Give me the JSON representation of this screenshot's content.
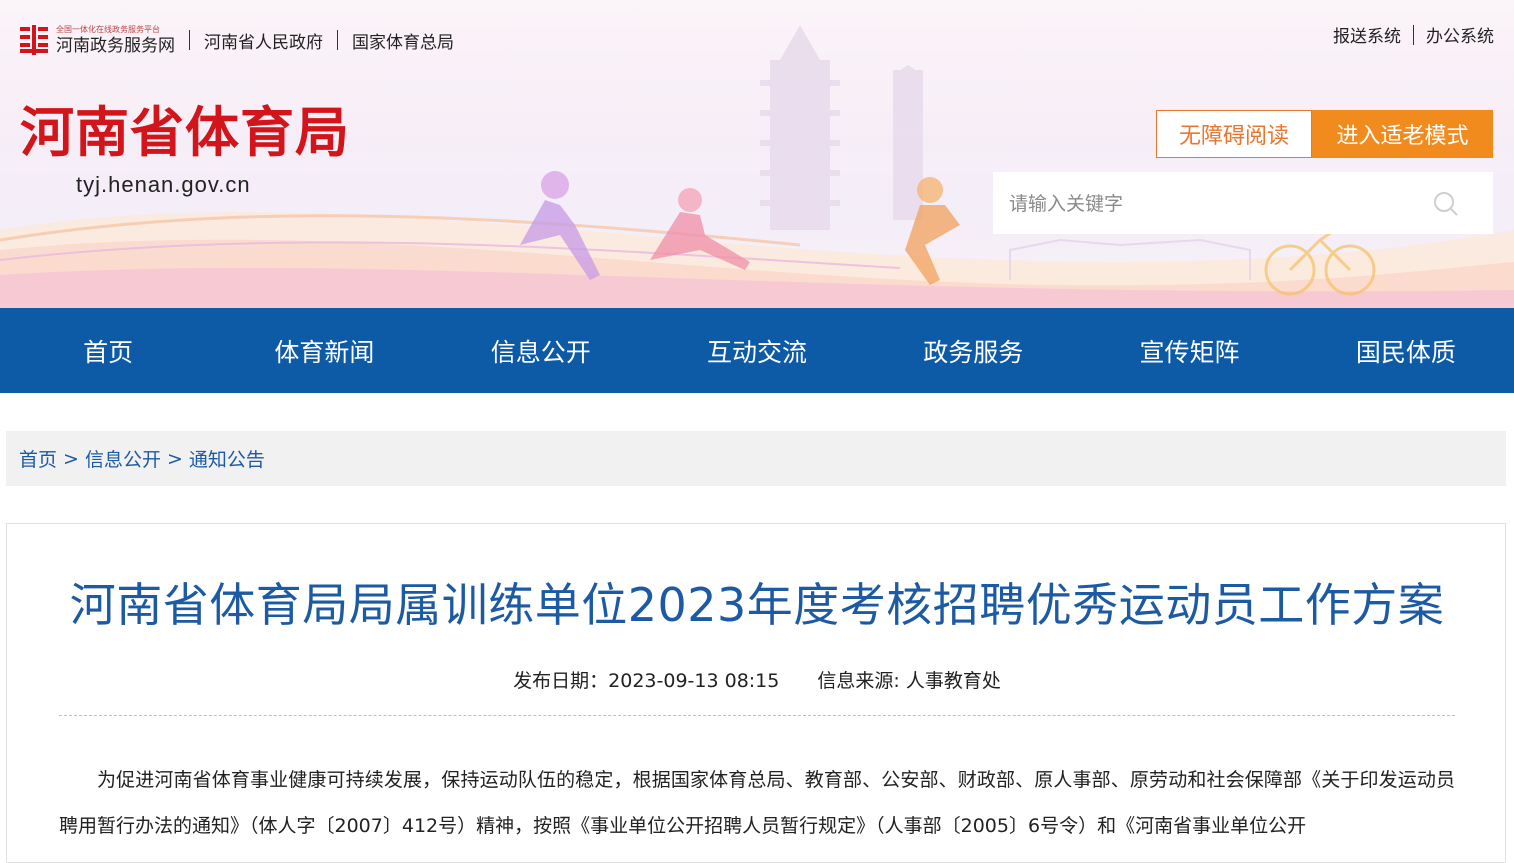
{
  "topbar": {
    "gov_logo_small": "全国一体化在线政务服务平台",
    "gov_logo_name": "河南政务服务网",
    "links": [
      "河南省人民政府",
      "国家体育总局"
    ],
    "right_links": [
      "报送系统",
      "办公系统"
    ]
  },
  "site": {
    "title": "河南省体育局",
    "url": "tyj.henan.gov.cn",
    "accessibility_button": "无障碍阅读",
    "elder_mode_button": "进入适老模式",
    "search_placeholder": "请输入关键字"
  },
  "nav": {
    "items": [
      "首页",
      "体育新闻",
      "信息公开",
      "互动交流",
      "政务服务",
      "宣传矩阵",
      "国民体质"
    ]
  },
  "breadcrumb": [
    "首页",
    "信息公开",
    "通知公告"
  ],
  "breadcrumb_separator": ">",
  "article": {
    "title": "河南省体育局局属训练单位2023年度考核招聘优秀运动员工作方案",
    "publish_date": "发布日期：2023-09-13 08:15",
    "source": "信息来源: 人事教育处",
    "body": "为促进河南省体育事业健康可持续发展，保持运动队伍的稳定，根据国家体育总局、教育部、公安部、财政部、原人事部、原劳动和社会保障部《关于印发运动员聘用暂行办法的通知》（体人字〔2007〕412号）精神，按照《事业单位公开招聘人员暂行规定》（人事部〔2005〕6号令）和《河南省事业单位公开"
  },
  "colors": {
    "brand_red": "#d2141b",
    "nav_blue": "#0d5aa7",
    "link_blue": "#1d5aa4",
    "orange": "#f28b1e"
  },
  "icons": [
    "gov-service-logo-icon",
    "search-icon"
  ]
}
